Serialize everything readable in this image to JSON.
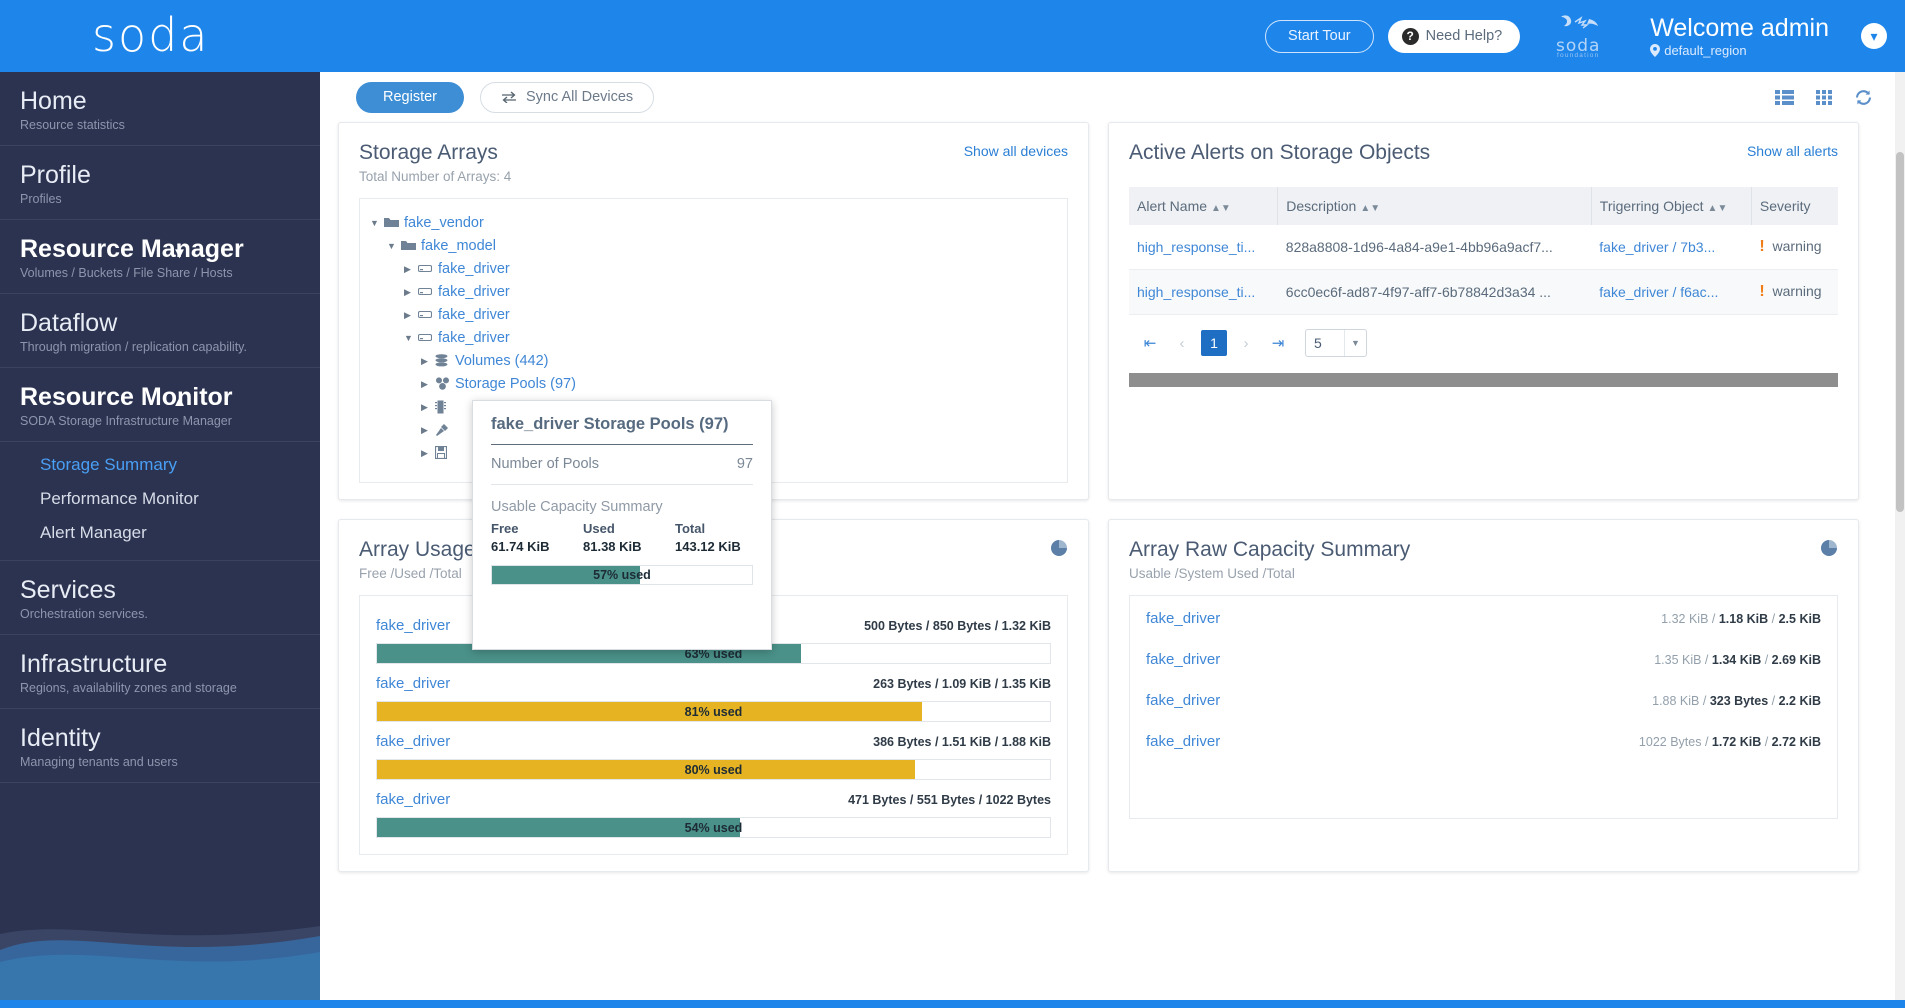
{
  "header": {
    "logo_text": "soda",
    "start_tour_label": "Start Tour",
    "need_help_label": "Need Help?",
    "brand_badge": "soda",
    "brand_badge_sub": "foundation",
    "welcome_text": "Welcome admin",
    "region_text": "default_region",
    "region_icon": "location-pin-icon",
    "chevron_icon": "chevron-down-icon",
    "bg_color": "#1e86eb"
  },
  "sidebar": {
    "items": [
      {
        "title": "Home",
        "sub": "Resource statistics",
        "caret": "",
        "bold": false
      },
      {
        "title": "Profile",
        "sub": "Profiles",
        "caret": "",
        "bold": false
      },
      {
        "title": "Resource Manager",
        "sub": "Volumes / Buckets / File Share / Hosts",
        "caret": "⌄",
        "bold": true
      },
      {
        "title": "Dataflow",
        "sub": "Through migration / replication capability.",
        "caret": "",
        "bold": false
      },
      {
        "title": "Resource Monitor",
        "sub": "SODA Storage Infrastructure Manager",
        "caret": "⌃",
        "bold": true
      }
    ],
    "sub_items": [
      {
        "label": "Storage Summary",
        "active": true
      },
      {
        "label": "Performance Monitor",
        "active": false
      },
      {
        "label": "Alert Manager",
        "active": false
      }
    ],
    "items_after": [
      {
        "title": "Services",
        "sub": "Orchestration services.",
        "caret": "",
        "bold": false
      },
      {
        "title": "Infrastructure",
        "sub": "Regions, availability zones and storage",
        "caret": "",
        "bold": false
      },
      {
        "title": "Identity",
        "sub": "Managing tenants and users",
        "caret": "",
        "bold": false
      }
    ],
    "bg_color": "#2b3350",
    "active_color": "#4a9ff5"
  },
  "toolbar": {
    "register_label": "Register",
    "sync_label": "Sync All Devices",
    "sync_icon": "sync-arrows-icon",
    "list_view_icon": "list-view-icon",
    "grid_view_icon": "grid-view-icon",
    "refresh_icon": "refresh-icon"
  },
  "storage_arrays": {
    "title": "Storage Arrays",
    "subtitle": "Total Number of Arrays: 4",
    "link": "Show all devices",
    "tree": [
      {
        "label": "fake_vendor",
        "indent": 0,
        "caret": "▼",
        "icon": "folder-open-icon"
      },
      {
        "label": "fake_model",
        "indent": 1,
        "caret": "▼",
        "icon": "folder-open-icon"
      },
      {
        "label": "fake_driver",
        "indent": 2,
        "caret": "▶",
        "icon": "storage-array-icon"
      },
      {
        "label": "fake_driver",
        "indent": 2,
        "caret": "▶",
        "icon": "storage-array-icon"
      },
      {
        "label": "fake_driver",
        "indent": 2,
        "caret": "▶",
        "icon": "storage-array-icon"
      },
      {
        "label": "fake_driver",
        "indent": 2,
        "caret": "▼",
        "icon": "storage-array-icon"
      },
      {
        "label": "Volumes (442)",
        "indent": 3,
        "caret": "▶",
        "icon": "volumes-stack-icon"
      },
      {
        "label": "Storage Pools (97)",
        "indent": 3,
        "caret": "▶",
        "icon": "storage-pools-icon"
      },
      {
        "label": "",
        "indent": 3,
        "caret": "▶",
        "icon": "controller-chip-icon"
      },
      {
        "label": "",
        "indent": 3,
        "caret": "▶",
        "icon": "port-plug-icon"
      },
      {
        "label": "",
        "indent": 3,
        "caret": "▶",
        "icon": "disk-save-icon"
      }
    ]
  },
  "popover": {
    "title": "fake_driver Storage Pools (97)",
    "row_label": "Number of Pools",
    "row_value": "97",
    "section_label": "Usable Capacity Summary",
    "columns": [
      {
        "head": "Free",
        "value": "61.74 KiB"
      },
      {
        "head": "Used",
        "value": "81.38 KiB"
      },
      {
        "head": "Total",
        "value": "143.12 KiB"
      }
    ],
    "bar_text": "57% used",
    "bar_percent": 57,
    "bar_color": "#4a9189"
  },
  "alerts": {
    "title": "Active Alerts on Storage Objects",
    "link": "Show all alerts",
    "columns": [
      "Alert Name",
      "Description",
      "Trigerring Object",
      "Severity"
    ],
    "rows": [
      {
        "alert_name": "high_response_ti...",
        "description": "828a8808-1d96-4a84-a9e1-4bb96a9acf7...",
        "object": "fake_driver / 7b3...",
        "severity": "warning",
        "severity_icon": "exclamation-icon"
      },
      {
        "alert_name": "high_response_ti...",
        "description": "6cc0ec6f-ad87-4f97-aff7-6b78842d3a34 ...",
        "object": "fake_driver / f6ac...",
        "severity": "warning",
        "severity_icon": "exclamation-icon"
      }
    ],
    "pager": {
      "first_icon": "first-page-icon",
      "prev_icon": "prev-page-icon",
      "current_page": "1",
      "next_icon": "next-page-icon",
      "last_icon": "last-page-icon",
      "page_size": "5",
      "dropdown_icon": "chevron-down-icon"
    }
  },
  "array_usage": {
    "title": "Array Usage Capacity Summary",
    "subtitle": "Free /Used /Total",
    "pie_icon": "pie-chart-icon",
    "rows": [
      {
        "name": "fake_driver",
        "values": "500 Bytes / 850 Bytes / 1.32 KiB",
        "percent": 63,
        "bar_text": "63% used",
        "color": "#4a9189"
      },
      {
        "name": "fake_driver",
        "values": "263 Bytes / 1.09 KiB / 1.35 KiB",
        "percent": 81,
        "bar_text": "81% used",
        "color": "#e6b422"
      },
      {
        "name": "fake_driver",
        "values": "386 Bytes / 1.51 KiB / 1.88 KiB",
        "percent": 80,
        "bar_text": "80% used",
        "color": "#e6b422"
      },
      {
        "name": "fake_driver",
        "values": "471 Bytes / 551 Bytes / 1022 Bytes",
        "percent": 54,
        "bar_text": "54% used",
        "color": "#4a9189"
      }
    ]
  },
  "array_raw": {
    "title": "Array Raw Capacity Summary",
    "subtitle": "Usable /System Used /Total",
    "pie_icon": "pie-chart-icon",
    "rows": [
      {
        "name": "fake_driver",
        "usable": "1.32 KiB",
        "system_used": "1.18 KiB",
        "total": "2.5 KiB"
      },
      {
        "name": "fake_driver",
        "usable": "1.35 KiB",
        "system_used": "1.34 KiB",
        "total": "2.69 KiB"
      },
      {
        "name": "fake_driver",
        "usable": "1.88 KiB",
        "system_used": "323 Bytes",
        "total": "2.2 KiB"
      },
      {
        "name": "fake_driver",
        "usable": "1022 Bytes",
        "system_used": "1.72 KiB",
        "total": "2.72 KiB"
      }
    ]
  }
}
